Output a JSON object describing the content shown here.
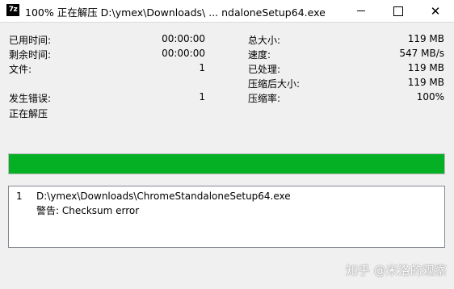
{
  "window": {
    "icon_text": "7z",
    "title": "100% 正在解压 D:\\ymex\\Downloads\\ ... ndaloneSetup64.exe",
    "minimize_glyph": "—",
    "close_glyph": "✕"
  },
  "stats_left": {
    "elapsed_label": "已用时间:",
    "elapsed_value": "00:00:00",
    "remaining_label": "剩余时间:",
    "remaining_value": "00:00:00",
    "files_label": "文件:",
    "files_value": "1",
    "errors_label": "发生错误:",
    "errors_value": "1",
    "status": "正在解压"
  },
  "stats_right": {
    "total_label": "总大小:",
    "total_value": "119 MB",
    "speed_label": "速度:",
    "speed_value": "547 MB/s",
    "processed_label": "已处理:",
    "processed_value": "119 MB",
    "compressed_label": "压缩后大小:",
    "compressed_value": "119 MB",
    "ratio_label": "压缩率:",
    "ratio_value": "100%"
  },
  "progress": {
    "fraction": 1.0,
    "color": "#06b025"
  },
  "messages": [
    {
      "index": "1",
      "path": "D:\\ymex\\Downloads\\ChromeStandaloneSetup64.exe",
      "warning": "警告: Checksum error"
    }
  ],
  "watermark": "知乎 @米洛的观察"
}
